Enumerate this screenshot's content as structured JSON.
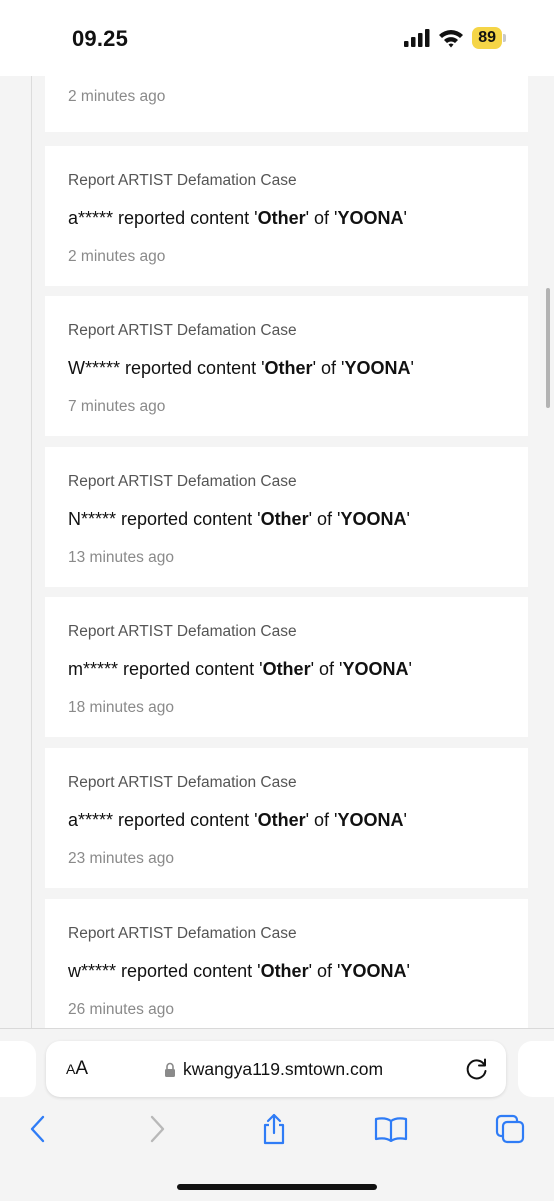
{
  "status_bar": {
    "time": "09.25",
    "battery": "89",
    "battery_color": "#f5d547"
  },
  "feed": {
    "partial_card_time": "2 minutes ago",
    "cards": [
      {
        "title": "Report ARTIST Defamation Case",
        "user": "a*****",
        "middle1": " reported content '",
        "content": "Other",
        "middle2": "' of '",
        "artist": "YOONA",
        "end": "'",
        "time": "2 minutes ago"
      },
      {
        "title": "Report ARTIST Defamation Case",
        "user": "W*****",
        "middle1": " reported content '",
        "content": "Other",
        "middle2": "' of '",
        "artist": "YOONA",
        "end": "'",
        "time": "7 minutes ago"
      },
      {
        "title": "Report ARTIST Defamation Case",
        "user": "N*****",
        "middle1": " reported content '",
        "content": "Other",
        "middle2": "' of '",
        "artist": "YOONA",
        "end": "'",
        "time": "13 minutes ago"
      },
      {
        "title": "Report ARTIST Defamation Case",
        "user": "m*****",
        "middle1": " reported content '",
        "content": "Other",
        "middle2": "' of '",
        "artist": "YOONA",
        "end": "'",
        "time": "18 minutes ago"
      },
      {
        "title": "Report ARTIST Defamation Case",
        "user": "a*****",
        "middle1": " reported content '",
        "content": "Other",
        "middle2": "' of '",
        "artist": "YOONA",
        "end": "'",
        "time": "23 minutes ago"
      },
      {
        "title": "Report ARTIST Defamation Case",
        "user": "w*****",
        "middle1": " reported content '",
        "content": "Other",
        "middle2": "' of '",
        "artist": "YOONA",
        "end": "'",
        "time": "26 minutes ago"
      }
    ]
  },
  "browser": {
    "aa_large": "A",
    "aa_small": "A",
    "url": "kwangya119.smtown.com",
    "accent_color": "#2f7cf6",
    "icons": [
      "lock-icon",
      "reload-icon",
      "back-icon",
      "forward-icon",
      "share-icon",
      "bookmarks-icon",
      "tabs-icon"
    ]
  }
}
